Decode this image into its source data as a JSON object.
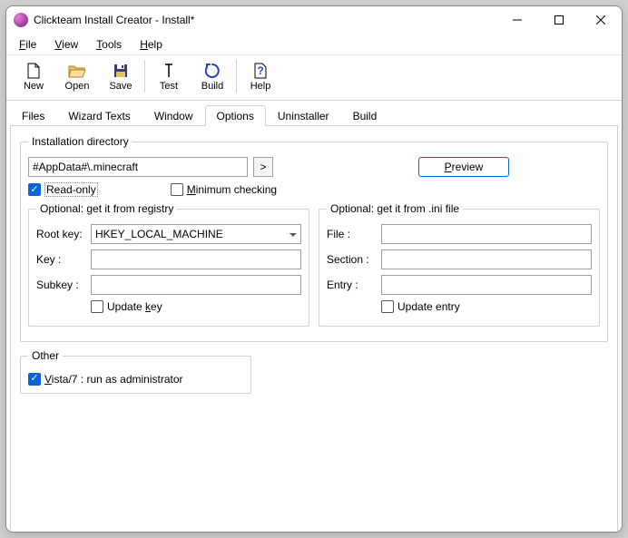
{
  "titlebar": {
    "title": "Clickteam Install Creator - Install*"
  },
  "menubar": [
    "File",
    "View",
    "Tools",
    "Help"
  ],
  "toolbar": {
    "new": "New",
    "open": "Open",
    "save": "Save",
    "test": "Test",
    "build": "Build",
    "help": "Help"
  },
  "tabs": {
    "files": "Files",
    "wizard": "Wizard Texts",
    "window": "Window",
    "options": "Options",
    "uninstaller": "Uninstaller",
    "build": "Build"
  },
  "options": {
    "groupTitle": "Installation directory",
    "path": "#AppData#\\.minecraft",
    "browseBtn": ">",
    "preview": "Preview",
    "readonly": {
      "label": "Read-only",
      "checked": true
    },
    "minimum": {
      "label": "Minimum checking",
      "checked": false
    },
    "registry": {
      "title": "Optional: get it from registry",
      "rootKeyLabel": "Root key:",
      "rootKey": "HKEY_LOCAL_MACHINE",
      "keyLabel": "Key :",
      "key": "",
      "subkeyLabel": "Subkey :",
      "subkey": "",
      "updateKey": {
        "label": "Update key",
        "checked": false,
        "underline": "k"
      }
    },
    "ini": {
      "title": "Optional: get it from .ini file",
      "fileLabel": "File :",
      "file": "",
      "sectionLabel": "Section :",
      "section": "",
      "entryLabel": "Entry :",
      "entry": "",
      "updateEntry": {
        "label": "Update entry",
        "checked": false
      }
    },
    "other": {
      "title": "Other",
      "vista": {
        "label": "Vista/7 : run as administrator",
        "checked": true,
        "underline": "V"
      }
    }
  }
}
